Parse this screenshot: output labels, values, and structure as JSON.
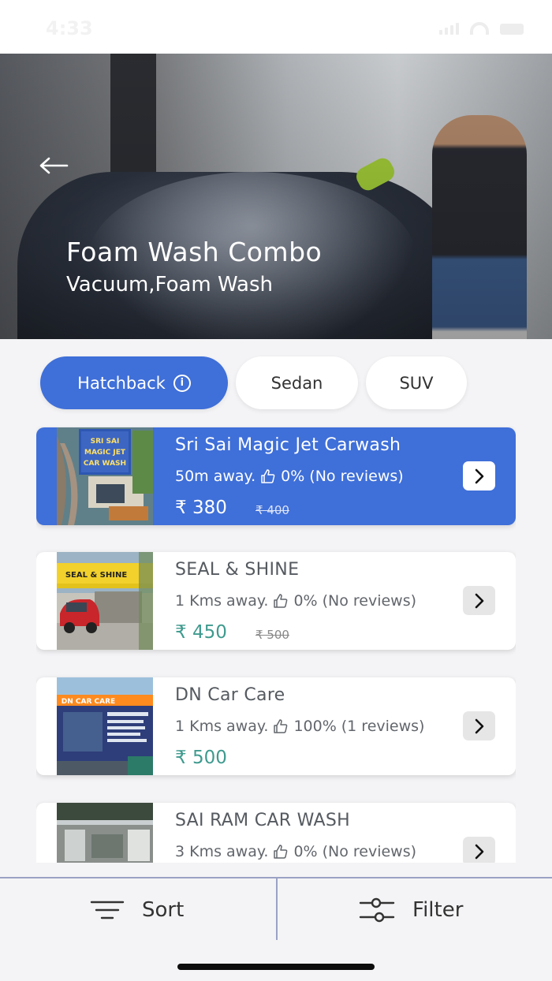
{
  "status_bar": {
    "time": "4:33"
  },
  "hero": {
    "title": "Foam Wash Combo",
    "subtitle": "Vacuum,Foam Wash"
  },
  "tabs": [
    {
      "label": "Hatchback",
      "active": true,
      "icon": "info-icon"
    },
    {
      "label": "Sedan",
      "active": false
    },
    {
      "label": "SUV",
      "active": false
    }
  ],
  "listings": [
    {
      "name": "Sri Sai Magic Jet Carwash",
      "distance": "50m away.",
      "rating": "0%",
      "reviews": "(No reviews)",
      "price": "₹ 380",
      "mrp": "₹ 400",
      "selected": true,
      "thumbnail_text": "SRI SAI MAGIC JET CAR WASH"
    },
    {
      "name": "SEAL & SHINE",
      "distance": "1 Kms away.",
      "rating": "0%",
      "reviews": "(No reviews)",
      "price": "₹ 450",
      "mrp": "₹ 500",
      "selected": false,
      "thumbnail_text": "SEAL & SHINE"
    },
    {
      "name": "DN Car Care",
      "distance": "1 Kms away.",
      "rating": "100%",
      "reviews": "(1 reviews)",
      "price": "₹ 500",
      "mrp": "",
      "selected": false,
      "thumbnail_text": "DN CAR CARE"
    },
    {
      "name": "SAI RAM CAR WASH",
      "distance": "3 Kms away.",
      "rating": "0%",
      "reviews": "(No reviews)",
      "price": "",
      "mrp": "",
      "selected": false,
      "thumbnail_text": ""
    }
  ],
  "bottom_bar": {
    "sort_label": "Sort",
    "filter_label": "Filter"
  },
  "colors": {
    "accent": "#3f6fd8",
    "price_green": "#3f9a8e",
    "divider": "#9aa3c4"
  }
}
